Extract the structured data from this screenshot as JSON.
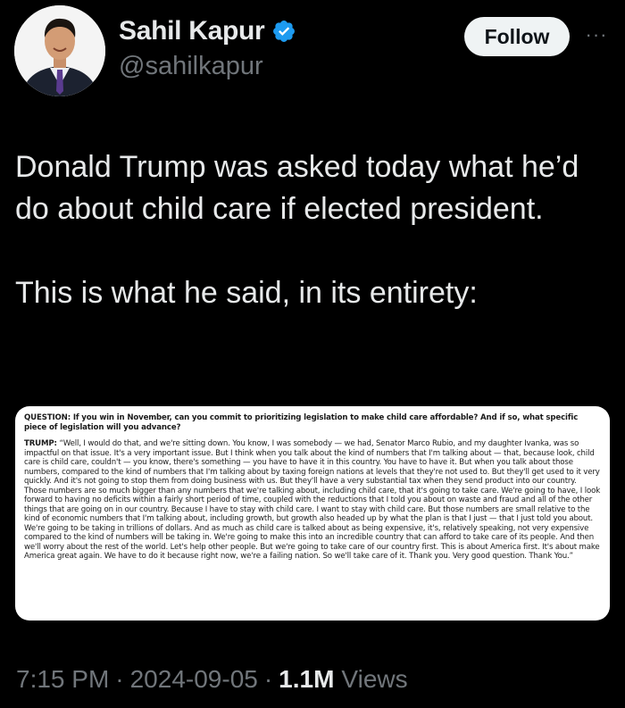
{
  "author": {
    "display_name": "Sahil Kapur",
    "handle": "@sahilkapur",
    "verified": true
  },
  "actions": {
    "follow_label": "Follow",
    "more_label": "···"
  },
  "tweet": {
    "paragraph_1": "Donald Trump was asked today what he’d do about child care if elected president.",
    "paragraph_2": "This is what he said, in its entirety:"
  },
  "media": {
    "question": "QUESTION: If you win in November, can you commit to prioritizing legislation to make child care affordable? And if so, what specific piece of legislation will you advance?",
    "answer_speaker": "TRUMP:",
    "answer_text": "“Well, I would do that, and we're sitting down. You know, I was somebody — we had, Senator Marco Rubio, and my daughter Ivanka, was so impactful on that issue. It's a very important issue. But I think when you talk about the kind of numbers that I'm talking about — that, because look, child care is child care, couldn't — you know, there's something — you have to have it in this country. You have to have it. But when you talk about those numbers, compared to the kind of numbers that I'm talking about by taxing foreign nations at levels that they're not used to. But they'll get used to it very quickly. And it's not going to stop them from doing business with us. But they'll have a very substantial tax when they send product into our country. Those numbers are so much bigger than any numbers that we're talking about, including child care, that it's going to take care. We're going to have, I look forward to having no deficits within a fairly short period of time, coupled with the reductions that I told you about on waste and fraud and all of the other things that are going on in our country. Because I have to stay with child care. I want to stay with child care. But those numbers are small relative to the kind of economic numbers that I'm talking about, including growth, but growth also headed up by what the plan is that I just — that I just told you about. We're going to be taking in trillions of dollars. And as much as child care is talked about as being expensive, it's, relatively speaking, not very expensive compared to the kind of numbers will be taking in. We're going to make this into an incredible country that can afford to take care of its people. And then we'll worry about the rest of the world. Let's help other people. But we're going to take care of our country first. This is about America first. It's about make America great again. We have to do it because right now, we're a failing nation. So we'll take care of it. Thank you. Very good question. Thank You.”"
  },
  "meta": {
    "time": "7:15 PM",
    "date": "2024-09-05",
    "separator": "·",
    "views_count": "1.1M",
    "views_label": "Views"
  },
  "colors": {
    "background": "#000000",
    "text_primary": "#e7e9ea",
    "text_secondary": "#71767b",
    "verified_blue": "#1d9bf0",
    "follow_bg": "#eff3f4"
  }
}
